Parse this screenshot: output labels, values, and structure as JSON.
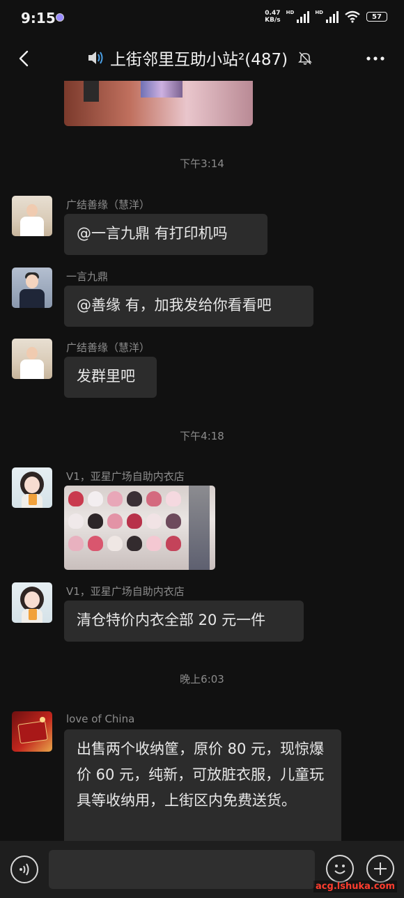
{
  "status_bar": {
    "time": "9:15",
    "net_speed_value": "0.47",
    "net_speed_unit": "KB/s",
    "hd1": "HD",
    "hd2": "HD",
    "battery": "57"
  },
  "header": {
    "title": "上街邻里互助小站²(487)",
    "icons": [
      "back-icon",
      "speaker-icon",
      "mute-bell-icon",
      "more-icon"
    ]
  },
  "messages": [
    {
      "type": "timestamp",
      "text": "下午3:14"
    },
    {
      "sender": "广结善缘（慧洋）",
      "text": "@一言九鼎  有打印机吗"
    },
    {
      "sender": "一言九鼎",
      "text": "@善缘 有，加我发给你看看吧"
    },
    {
      "sender": "广结善缘（慧洋）",
      "text": "发群里吧"
    },
    {
      "type": "timestamp",
      "text": "下午4:18"
    },
    {
      "sender": "V1，亚星广场自助内衣店",
      "text": ""
    },
    {
      "sender": "V1，亚星广场自助内衣店",
      "text": "清仓特价内衣全部 20 元一件"
    },
    {
      "type": "timestamp",
      "text": "晚上6:03"
    },
    {
      "sender": "love of China",
      "text": "出售两个收纳筐，原价 80 元，现惊爆价 60 元，纯新，可放脏衣服，儿童玩具等收纳用，上街区内免费送货。"
    }
  ],
  "input_bar": {
    "placeholder": ""
  },
  "watermark": "acg.lshuka.com",
  "colors": {
    "background": "#111111",
    "bubble": "#2c2c2c",
    "text": "#e8e8e8",
    "muted": "#8c8c8c",
    "input_bar": "#1e1e1e"
  }
}
